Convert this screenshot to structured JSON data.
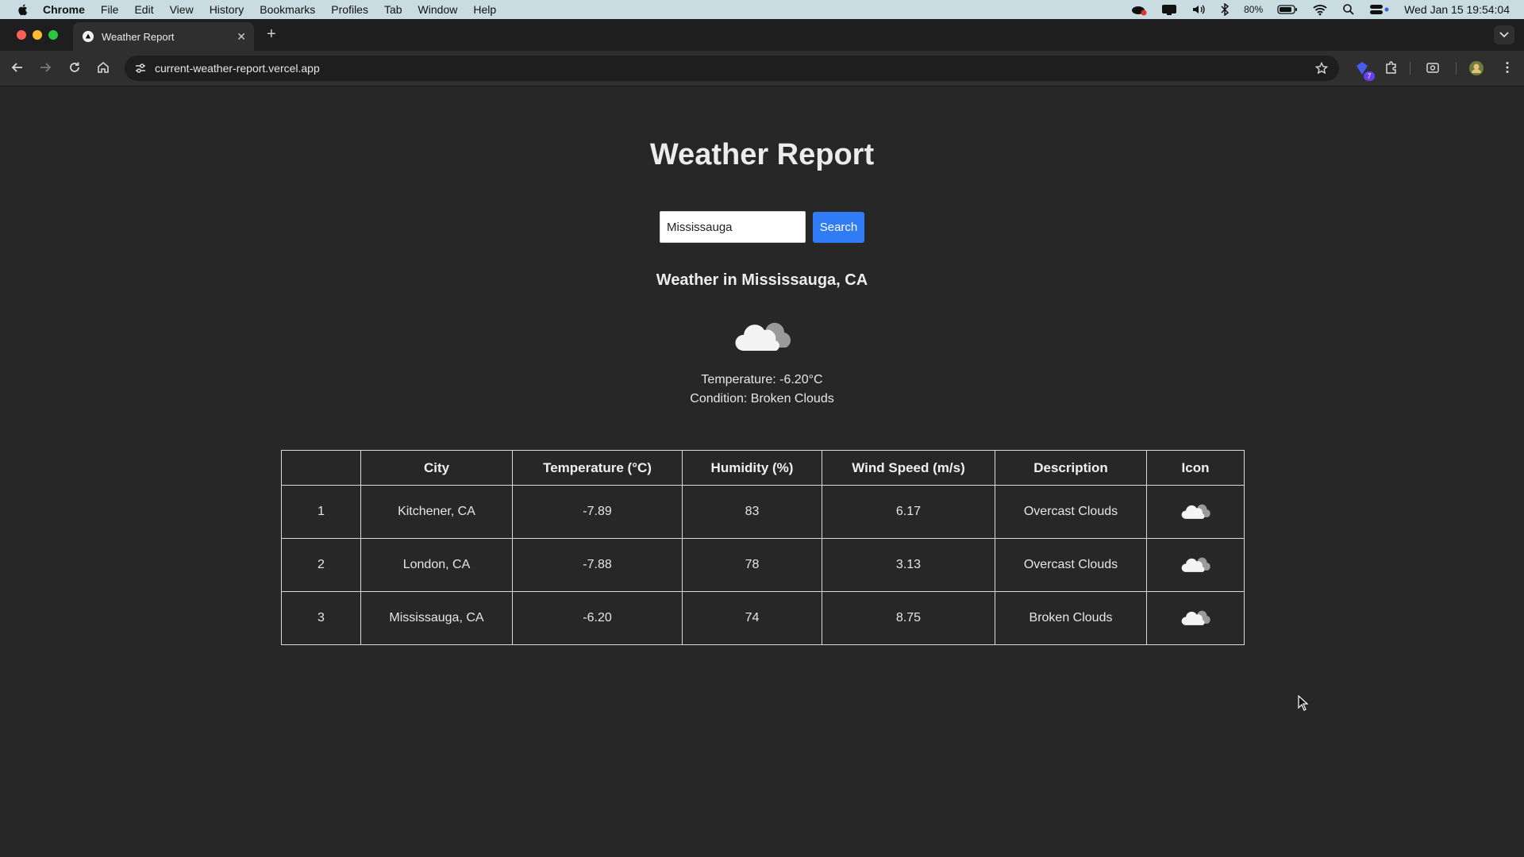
{
  "menubar": {
    "items": [
      "Chrome",
      "File",
      "Edit",
      "View",
      "History",
      "Bookmarks",
      "Profiles",
      "Tab",
      "Window",
      "Help"
    ],
    "battery": "80%",
    "datetime": "Wed Jan 15  19:54:04"
  },
  "browser": {
    "tab_title": "Weather Report",
    "url": "current-weather-report.vercel.app",
    "extension_badge": "7"
  },
  "page": {
    "title": "Weather Report",
    "search": {
      "value": "Mississauga",
      "button_label": "Search"
    },
    "current": {
      "heading": "Weather in Mississauga, CA",
      "icon": "broken-clouds-icon",
      "temperature": "Temperature: -6.20°C",
      "condition": "Condition: Broken Clouds"
    },
    "table": {
      "headers": [
        "",
        "City",
        "Temperature (°C)",
        "Humidity (%)",
        "Wind Speed (m/s)",
        "Description",
        "Icon"
      ],
      "rows": [
        {
          "index": "1",
          "city": "Kitchener, CA",
          "temperature": "-7.89",
          "humidity": "83",
          "wind": "6.17",
          "description": "Overcast Clouds",
          "icon": "overcast-clouds-icon"
        },
        {
          "index": "2",
          "city": "London, CA",
          "temperature": "-7.88",
          "humidity": "78",
          "wind": "3.13",
          "description": "Overcast Clouds",
          "icon": "overcast-clouds-icon"
        },
        {
          "index": "3",
          "city": "Mississauga, CA",
          "temperature": "-6.20",
          "humidity": "74",
          "wind": "8.75",
          "description": "Broken Clouds",
          "icon": "broken-clouds-icon"
        }
      ]
    }
  },
  "colors": {
    "page_bg": "#272727",
    "search_button": "#2f7cf6",
    "menubar_bg": "#c9dce2"
  }
}
